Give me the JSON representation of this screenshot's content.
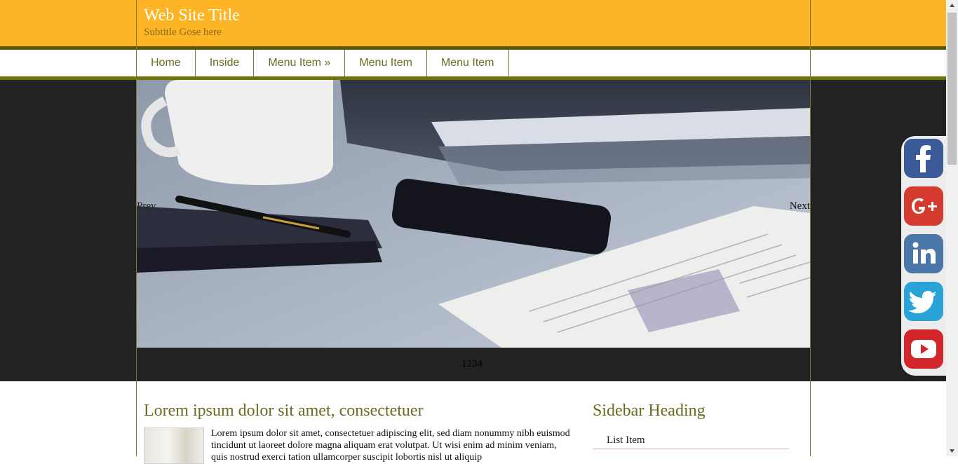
{
  "header": {
    "title": "Web Site Title",
    "subtitle": "Subtitle Gose here",
    "colors": {
      "header_bg": "#fdb525",
      "accent_olive": "#6f7408",
      "hero_bg": "#222222"
    }
  },
  "nav": {
    "items": [
      {
        "label": "Home"
      },
      {
        "label": "Inside"
      },
      {
        "label": "Menu Item »"
      },
      {
        "label": "Menu Item"
      },
      {
        "label": "Menu Item"
      }
    ]
  },
  "slider": {
    "prev_label": "Prev",
    "next_label": "Next",
    "pager": [
      "1",
      "2",
      "3",
      "4"
    ]
  },
  "post": {
    "title": "Lorem ipsum dolor sit amet, consectetuer",
    "body": "Lorem ipsum dolor sit amet, consectetuer adipiscing elit, sed diam nonummy nibh euismod tincidunt ut laoreet dolore magna aliquam erat volutpat. Ut wisi enim ad minim veniam, quis nostrud exerci tation ullamcorper suscipit lobortis nisl ut aliquip"
  },
  "sidebar": {
    "heading": "Sidebar Heading",
    "items": [
      {
        "label": "List Item"
      }
    ]
  },
  "social": [
    {
      "icon": "facebook-icon",
      "color": "#3b5a98"
    },
    {
      "icon": "google-plus-icon",
      "color": "#d53a2f"
    },
    {
      "icon": "linkedin-icon",
      "color": "#4a77a8"
    },
    {
      "icon": "twitter-icon",
      "color": "#2aa3d9"
    },
    {
      "icon": "youtube-icon",
      "color": "#d3262a"
    }
  ]
}
